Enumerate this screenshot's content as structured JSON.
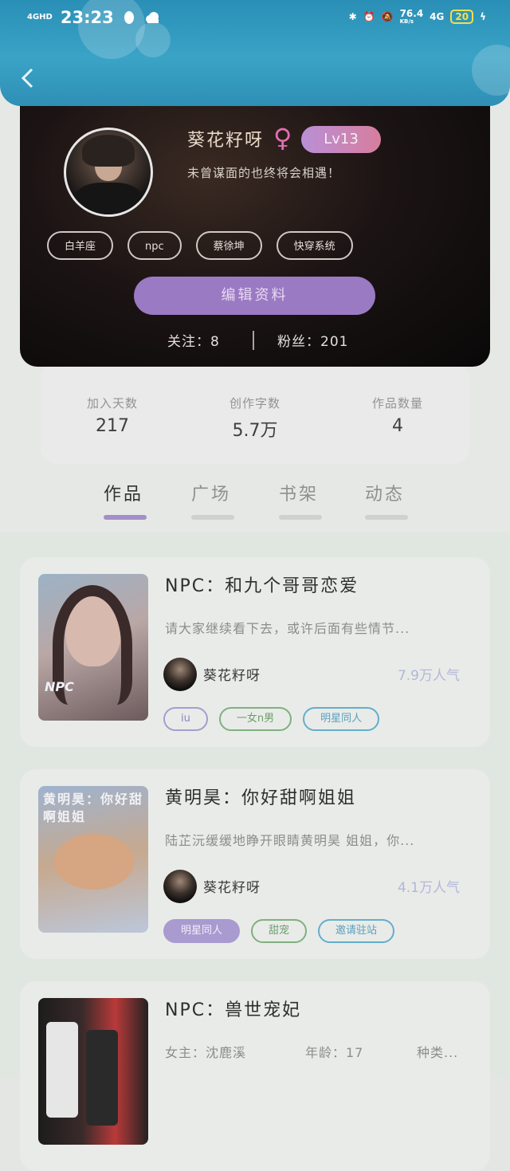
{
  "status_bar": {
    "network": "4GHD",
    "time": "23:23",
    "speed": "76.4",
    "speed_unit": "KB/s",
    "signal": "4G",
    "battery": "20"
  },
  "profile": {
    "username": "葵花籽呀",
    "gender_symbol": "♀",
    "level": "Lv13",
    "motto": "未曾谋面的也终将会相遇！",
    "tags": [
      "白羊座",
      "npc",
      "蔡徐坤",
      "快穿系统"
    ],
    "edit_label": "编辑资料",
    "following": "关注：8",
    "fans": "粉丝：201"
  },
  "stats": [
    {
      "label": "加入天数",
      "value": "217"
    },
    {
      "label": "创作字数",
      "value": "5.7万"
    },
    {
      "label": "作品数量",
      "value": "4"
    }
  ],
  "tabs": [
    {
      "label": "作品",
      "active": true
    },
    {
      "label": "广场",
      "active": false
    },
    {
      "label": "书架",
      "active": false
    },
    {
      "label": "动态",
      "active": false
    }
  ],
  "works": [
    {
      "title": "NPC：和九个哥哥恋爱",
      "description": "请大家继续看下去，或许后面有些情节...",
      "author": "葵花籽呀",
      "popularity": "7.9万人气",
      "cover_text": "NPC",
      "tags": [
        {
          "label": "iu",
          "color": "#a99ad0"
        },
        {
          "label": "一女n男",
          "color": "#7fb07f"
        },
        {
          "label": "明星同人",
          "color": "#63aecb"
        }
      ]
    },
    {
      "title": "黄明昊：你好甜啊姐姐",
      "description": "陆芷沅缓缓地睁开眼睛黄明昊 姐姐，你...",
      "author": "葵花籽呀",
      "popularity": "4.1万人气",
      "cover_text": "黄明昊：你好甜啊姐姐",
      "tags": [
        {
          "label": "明星同人",
          "color": "#a99ad0",
          "filled": true
        },
        {
          "label": "甜宠",
          "color": "#7fb07f"
        },
        {
          "label": "邀请驻站",
          "color": "#63aecb"
        }
      ]
    },
    {
      "title": "NPC：兽世宠妃",
      "heroine": "女主：沈鹿溪",
      "age": "年龄：17",
      "race": "种类..."
    }
  ]
}
